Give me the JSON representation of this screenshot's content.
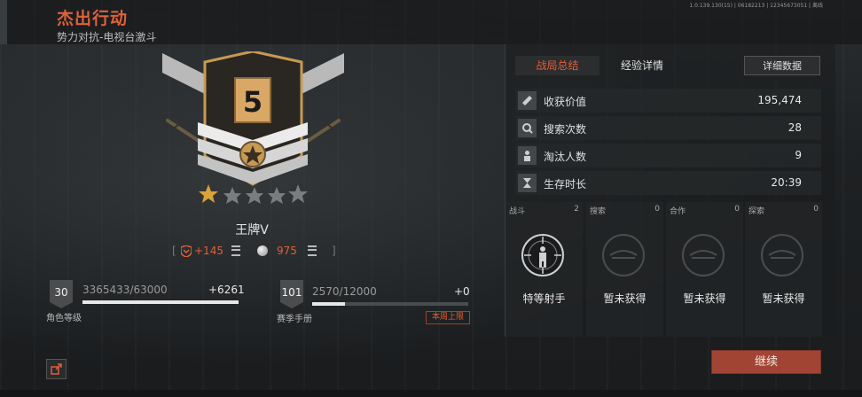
{
  "header": {
    "title": "杰出行动",
    "subtitle": "势力对抗-电视台激斗",
    "version": "1.0.139.130(15) | 06182213 | 12345673051 | 离线"
  },
  "rank": {
    "level_number": "5",
    "title": "王牌V",
    "stars_filled": 1,
    "stars_total": 5
  },
  "currencies": {
    "merit_gain": "+145",
    "coin_value": "975"
  },
  "progress": {
    "character": {
      "level": "30",
      "exp": "3365433/63000",
      "gain": "+6261",
      "label": "角色等级",
      "fill_fraction": 1.0
    },
    "season": {
      "level": "101",
      "exp": "2570/12000",
      "gain": "+0",
      "label": "赛季手册",
      "fill_fraction": 0.21,
      "limit_badge": "本周上限"
    }
  },
  "tabs": {
    "summary": "战局总结",
    "exp_detail": "经验详情",
    "detail_data": "详细数据"
  },
  "stats": [
    {
      "label": "收获价值",
      "value": "195,474",
      "icon": "loot-icon"
    },
    {
      "label": "搜索次数",
      "value": "28",
      "icon": "search-icon"
    },
    {
      "label": "淘汰人数",
      "value": "9",
      "icon": "eliminate-icon"
    },
    {
      "label": "生存时长",
      "value": "20:39",
      "icon": "hourglass-icon"
    }
  ],
  "categories": [
    {
      "name": "战斗",
      "count": "2",
      "award": "特等射手"
    },
    {
      "name": "搜索",
      "count": "0",
      "award": "暂未获得"
    },
    {
      "name": "合作",
      "count": "0",
      "award": "暂未获得"
    },
    {
      "name": "探索",
      "count": "0",
      "award": "暂未获得"
    }
  ],
  "buttons": {
    "continue": "继续"
  },
  "colors": {
    "accent": "#e0603a",
    "continue_bg": "#a24434"
  }
}
